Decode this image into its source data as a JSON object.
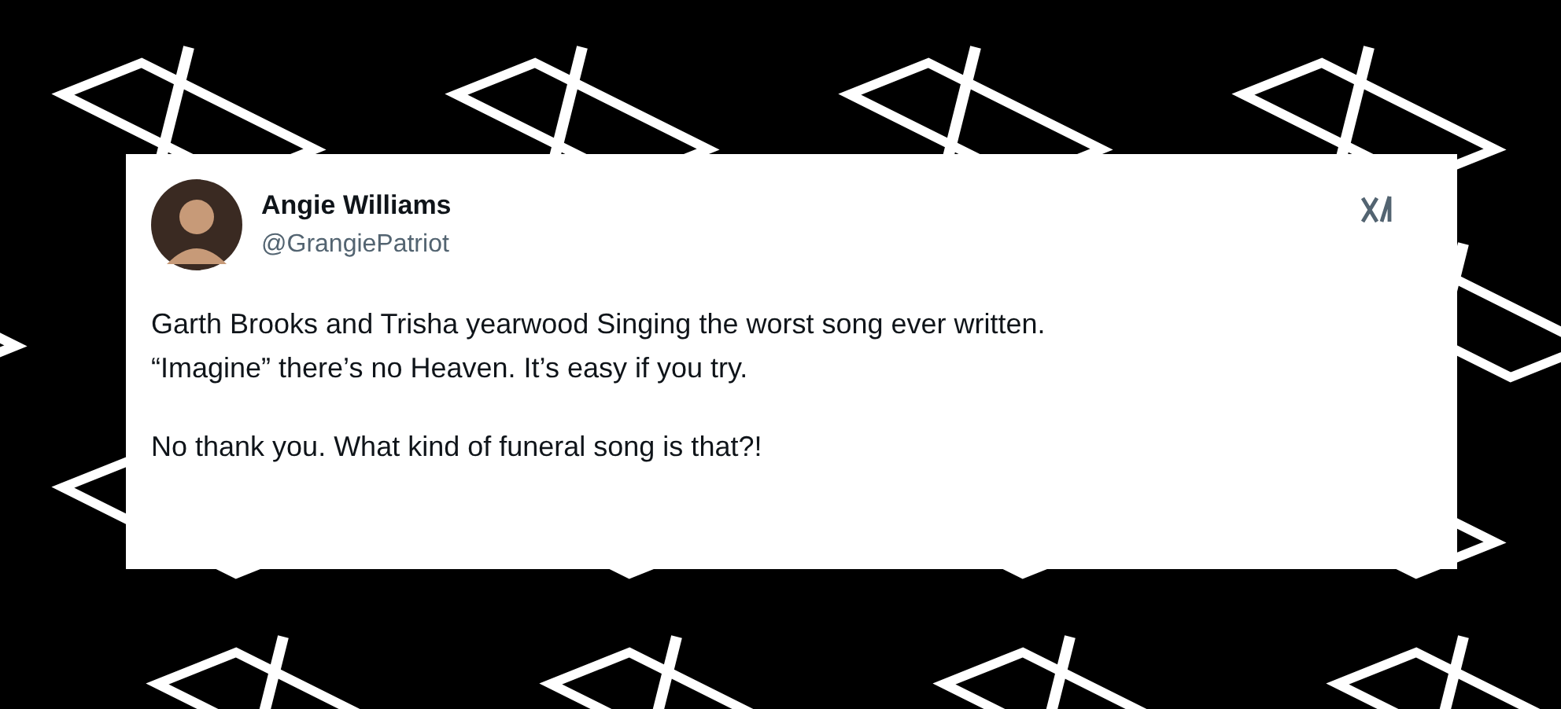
{
  "tweet": {
    "author_name": "Angie Williams",
    "handle": "@GrangiePatriot",
    "paragraphs": [
      "Garth Brooks and Trisha yearwood Singing the worst song ever written.\n“Imagine” there’s no Heaven. It’s easy if you try.",
      "No thank you. What kind of funeral song is that?!"
    ]
  }
}
